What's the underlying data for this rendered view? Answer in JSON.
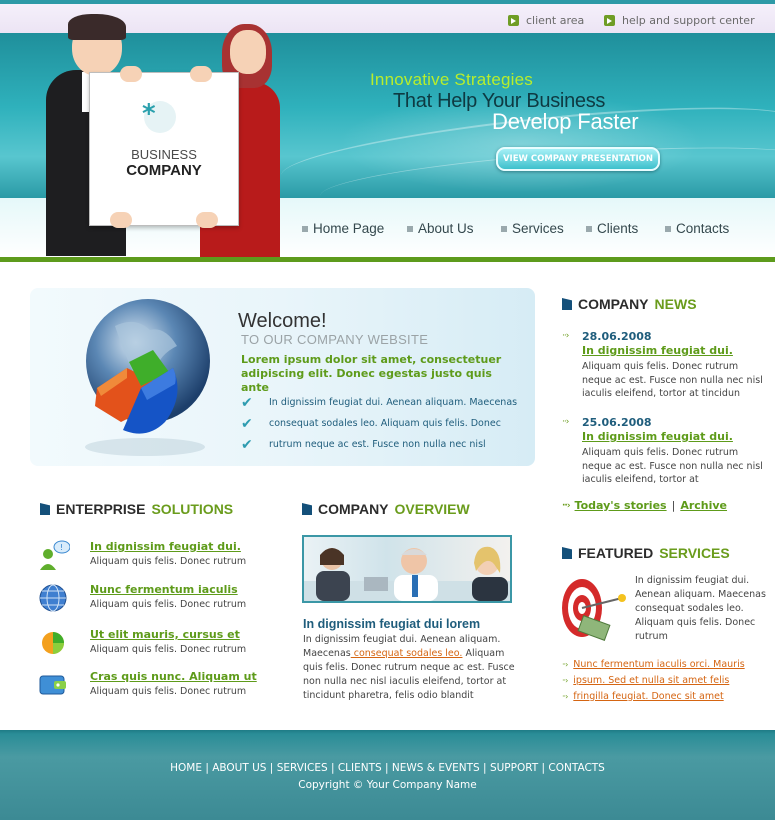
{
  "header": {
    "top_links": [
      "client area",
      "help and support center"
    ],
    "slogan": {
      "line1": "Innovative Strategies",
      "line2": "That Help Your Business",
      "line3": "Develop Faster"
    },
    "cta_label": "VIEW COMPANY PRESENTATION",
    "logo": {
      "line1": "BUSINESS",
      "line2": "COMPANY"
    },
    "nav": [
      "Home Page",
      "About Us",
      "Services",
      "Clients",
      "Contacts"
    ]
  },
  "welcome": {
    "title": "Welcome!",
    "subtitle": "TO OUR COMPANY WEBSITE",
    "lead": "Lorem ipsum dolor sit amet, consectetuer adipiscing elit. Donec egestas justo quis ante",
    "bullets": [
      "In dignissim feugiat dui. Aenean aliquam. Maecenas",
      "consequat sodales leo. Aliquam quis felis. Donec",
      "rutrum neque ac est. Fusce non nulla nec nisl"
    ]
  },
  "solutions": {
    "heading_a": "ENTERPRISE",
    "heading_b": "SOLUTIONS",
    "items": [
      {
        "icon": "users-chat-icon",
        "title": "In dignissim feugiat dui.",
        "text": "Aliquam quis felis. Donec rutrum"
      },
      {
        "icon": "globe-icon",
        "title": "Nunc fermentum iaculis",
        "text": "Aliquam quis felis. Donec rutrum"
      },
      {
        "icon": "pie-chart-icon",
        "title": "Ut elit mauris, cursus et",
        "text": "Aliquam quis felis. Donec rutrum"
      },
      {
        "icon": "wallet-icon",
        "title": "Cras quis nunc. Aliquam ut",
        "text": "Aliquam quis felis. Donec rutrum"
      }
    ]
  },
  "overview": {
    "heading_a": "COMPANY",
    "heading_b": "OVERVIEW",
    "title": "In dignissim feugiat dui lorem",
    "text_before": "In dignissim feugiat dui. Aenean aliquam. Maecenas",
    "text_link": " consequat sodales leo.",
    "text_after": " Aliquam quis felis. Donec rutrum neque ac est. Fusce non nulla nec nisl iaculis eleifend, tortor at tincidunt pharetra, felis odio blandit"
  },
  "news": {
    "heading_a": "COMPANY",
    "heading_b": "NEWS",
    "items": [
      {
        "date": "28.06.2008",
        "title": "In dignissim feugiat dui.",
        "text": "Aliquam quis felis. Donec rutrum neque ac est. Fusce non nulla nec nisl iaculis eleifend, tortor at tincidun"
      },
      {
        "date": "25.06.2008",
        "title": "In dignissim feugiat dui.",
        "text": "Aliquam quis felis. Donec rutrum neque ac est. Fusce non nulla nec nisl iaculis eleifend, tortor at"
      }
    ],
    "todays_stories": "Today's stories",
    "separator": "|",
    "archive": "Archive"
  },
  "featured": {
    "heading_a": "FEATURED",
    "heading_b": "SERVICES",
    "text": "In dignissim feugiat dui. Aenean aliquam. Maecenas consequat sodales leo. Aliquam quis felis. Donec rutrum",
    "links": [
      "Nunc fermentum iaculis orci. Mauris",
      "ipsum. Sed et nulla sit amet felis",
      "fringilla feugiat. Donec sit amet"
    ]
  },
  "footer": {
    "nav": [
      "HOME",
      "ABOUT US",
      "SERVICES",
      "CLIENTS",
      "NEWS & EVENTS",
      "SUPPORT",
      "CONTACTS"
    ],
    "separator": " | ",
    "copyright": "Copyright © Your Company Name"
  },
  "colors": {
    "teal": "#2d9aa7",
    "green": "#5e9b1a",
    "navy": "#1f5d7c",
    "orange": "#d56512"
  }
}
